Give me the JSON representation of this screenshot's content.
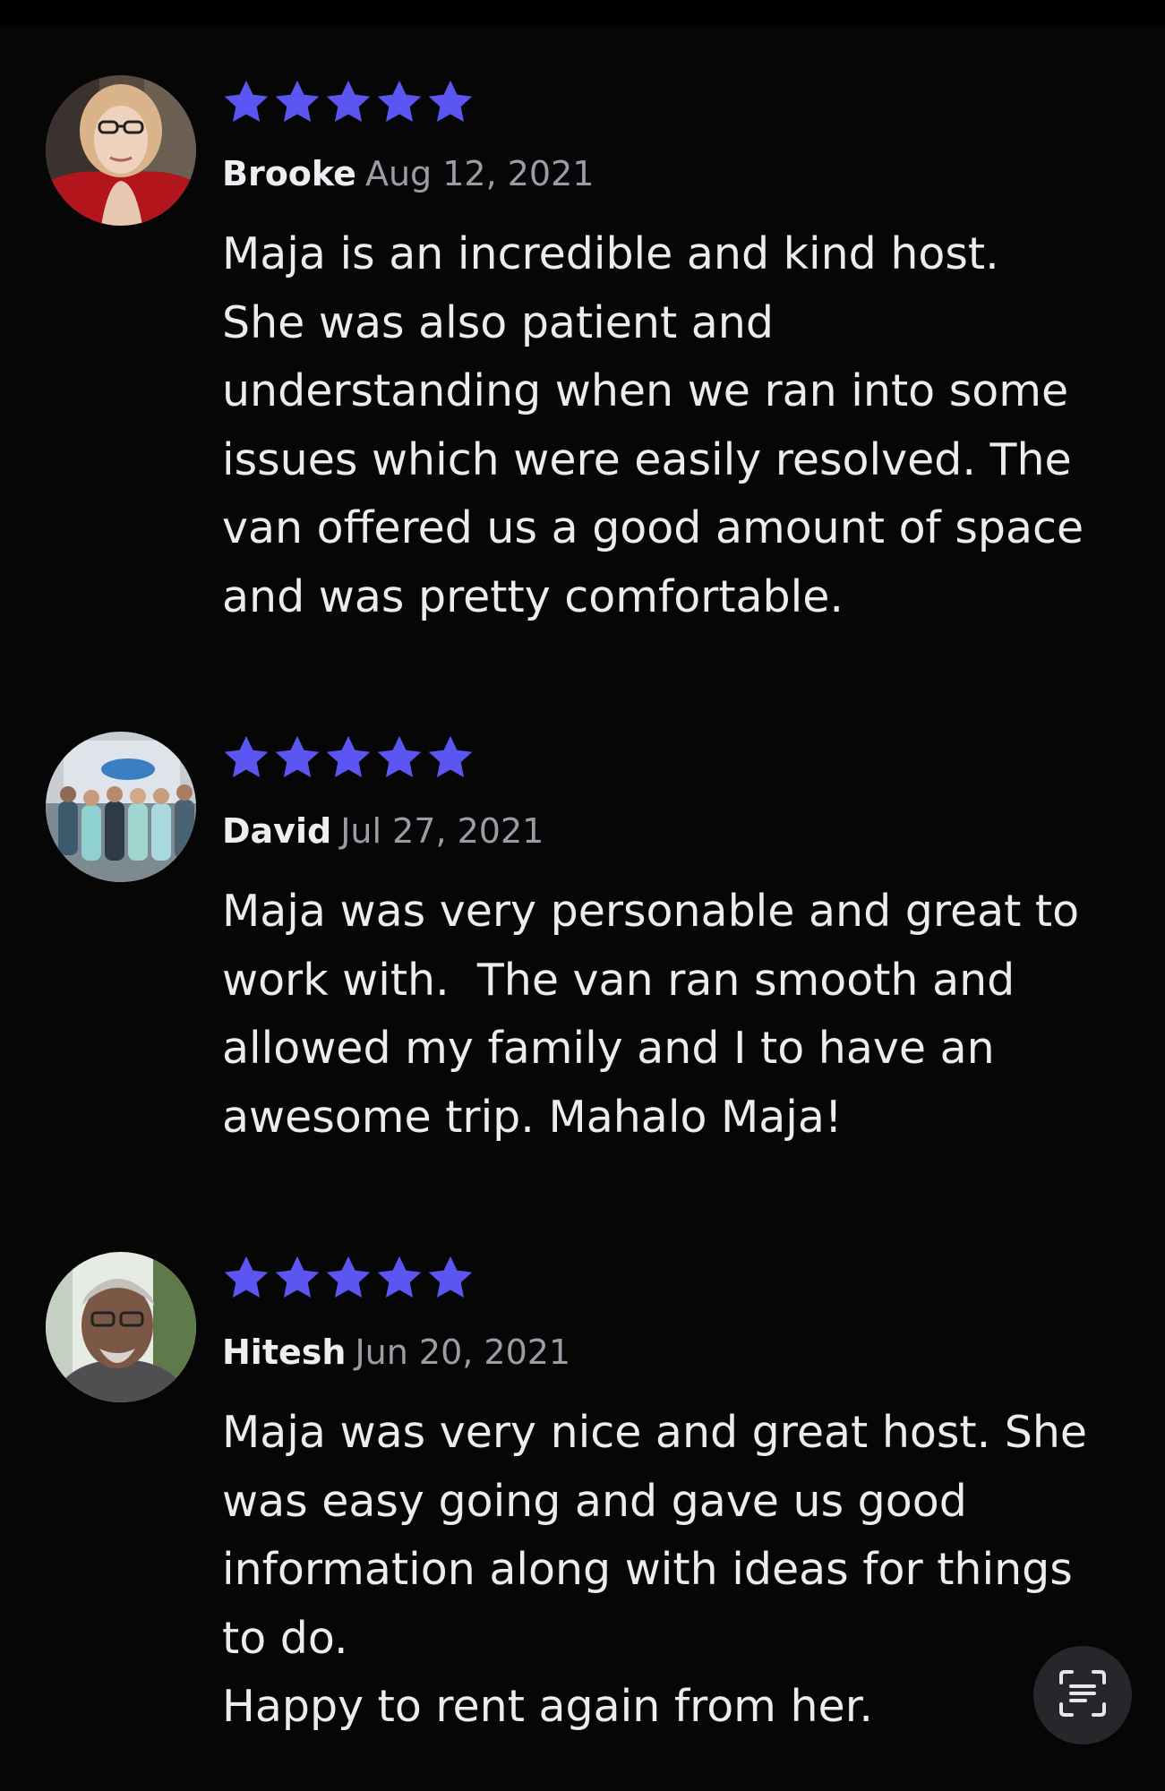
{
  "reviews": [
    {
      "author": "Brooke",
      "date": "Aug 12, 2021",
      "rating": 5,
      "text_lines": [
        "Maja is an incredible and kind host.",
        "She was also patient and",
        "understanding when we ran into some",
        "issues which were easily resolved. The",
        "van offered us a good amount of space",
        "and was pretty comfortable."
      ]
    },
    {
      "author": "David",
      "date": "Jul 27, 2021",
      "rating": 5,
      "text_lines": [
        "Maja was very personable and great to",
        "work with.  The van ran smooth and",
        "allowed my family and I to have an",
        "awesome trip. Mahalo Maja!"
      ]
    },
    {
      "author": "Hitesh",
      "date": "Jun 20, 2021",
      "rating": 5,
      "text_lines": [
        "Maja was very nice and great host. She",
        "was easy going and gave us good",
        "information along with ideas for things",
        "to do.",
        "Happy to rent again from her."
      ]
    }
  ],
  "floating_button": {
    "icon": "text-scan-icon"
  },
  "colors": {
    "background": "#060607",
    "star": "#5b55f2",
    "date": "#9c9ca6",
    "text": "#ececf0"
  }
}
